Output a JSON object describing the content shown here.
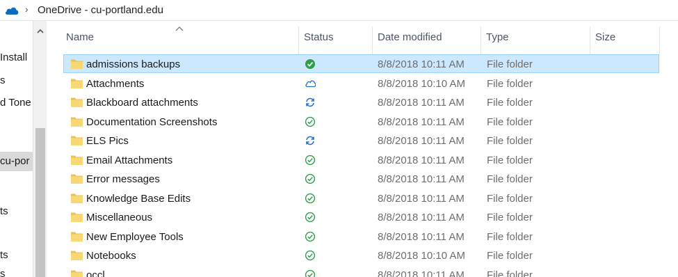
{
  "breadcrumb": {
    "separator": "›",
    "location": "OneDrive - cu-portland.edu"
  },
  "nav": {
    "items": [
      {
        "label": "Install",
        "selected": false
      },
      {
        "label": "s",
        "selected": false
      },
      {
        "label": "d Tone",
        "selected": false
      },
      {
        "label": "cu-por",
        "selected": true
      },
      {
        "label": "ts",
        "selected": false
      },
      {
        "label": "ts",
        "selected": false
      },
      {
        "label": "s",
        "selected": false
      }
    ]
  },
  "columns": {
    "name": "Name",
    "status": "Status",
    "date": "Date modified",
    "type": "Type",
    "size": "Size"
  },
  "colors": {
    "selection": "#cce8ff",
    "status_green": "#2e9e4a",
    "status_blue": "#1f6fd1"
  },
  "files": [
    {
      "name": "admissions backups",
      "status": "available-filled",
      "date": "8/8/2018 10:11 AM",
      "type": "File folder",
      "selected": true
    },
    {
      "name": "Attachments",
      "status": "cloud",
      "date": "8/8/2018 10:10 AM",
      "type": "File folder",
      "selected": false
    },
    {
      "name": "Blackboard attachments",
      "status": "syncing",
      "date": "8/8/2018 10:11 AM",
      "type": "File folder",
      "selected": false
    },
    {
      "name": "Documentation Screenshots",
      "status": "available",
      "date": "8/8/2018 10:11 AM",
      "type": "File folder",
      "selected": false
    },
    {
      "name": "ELS Pics",
      "status": "syncing",
      "date": "8/8/2018 10:11 AM",
      "type": "File folder",
      "selected": false
    },
    {
      "name": "Email Attachments",
      "status": "available",
      "date": "8/8/2018 10:11 AM",
      "type": "File folder",
      "selected": false
    },
    {
      "name": "Error messages",
      "status": "available",
      "date": "8/8/2018 10:11 AM",
      "type": "File folder",
      "selected": false
    },
    {
      "name": "Knowledge Base Edits",
      "status": "available",
      "date": "8/8/2018 10:11 AM",
      "type": "File folder",
      "selected": false
    },
    {
      "name": "Miscellaneous",
      "status": "available",
      "date": "8/8/2018 10:11 AM",
      "type": "File folder",
      "selected": false
    },
    {
      "name": "New Employee Tools",
      "status": "available",
      "date": "8/8/2018 10:11 AM",
      "type": "File folder",
      "selected": false
    },
    {
      "name": "Notebooks",
      "status": "available",
      "date": "8/8/2018 10:10 AM",
      "type": "File folder",
      "selected": false
    },
    {
      "name": "occl",
      "status": "available",
      "date": "8/8/2018 10:11 AM",
      "type": "File folder",
      "selected": false
    }
  ]
}
